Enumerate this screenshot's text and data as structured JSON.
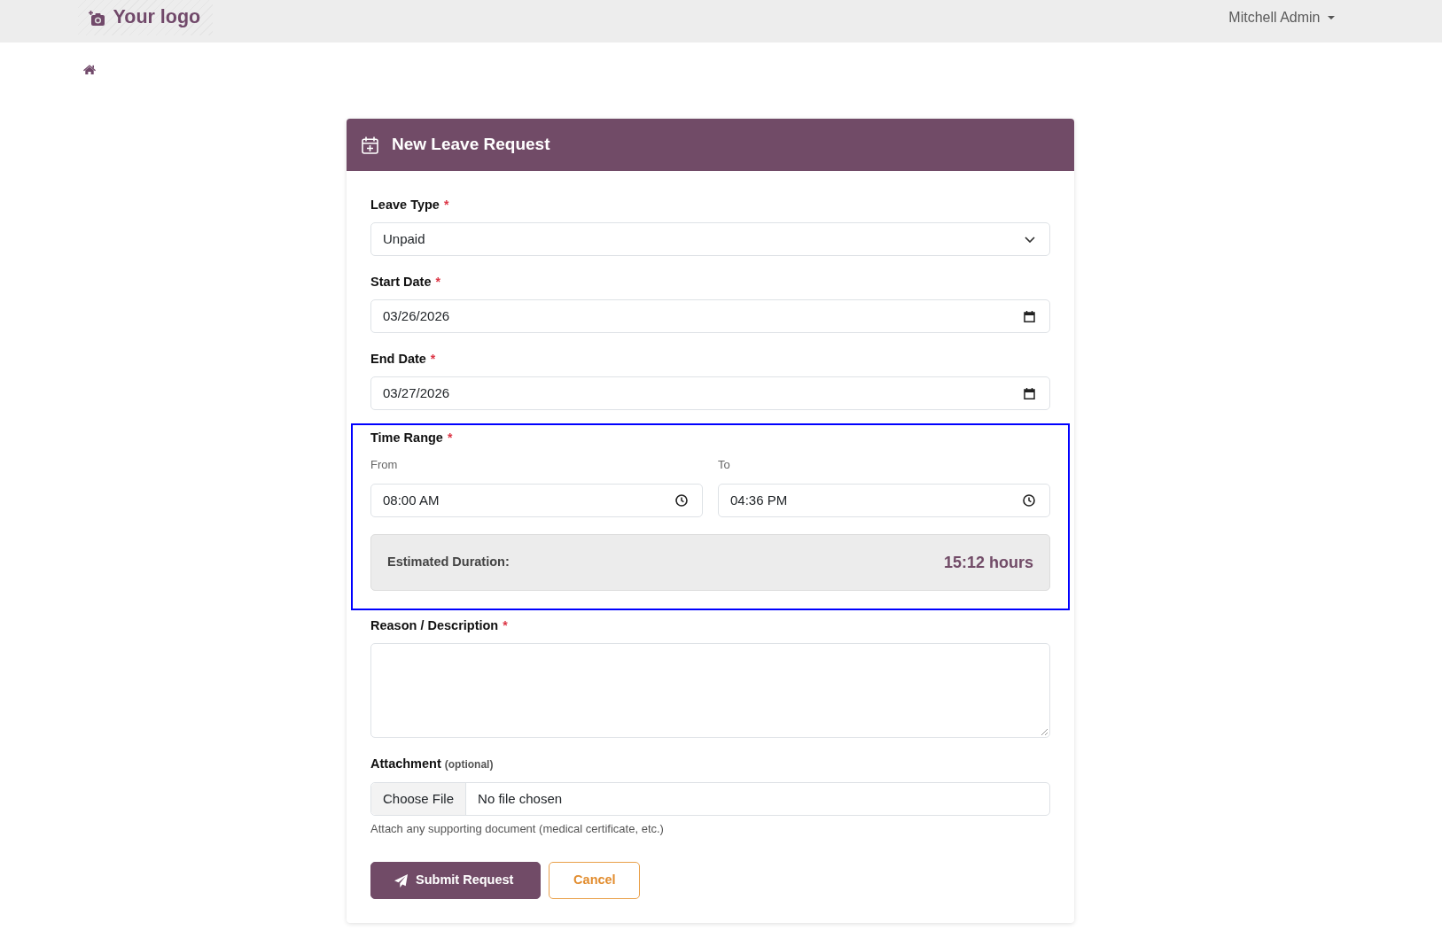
{
  "navbar": {
    "logo": "Your logo",
    "user_menu": "Mitchell Admin"
  },
  "form": {
    "title": "New Leave Request",
    "fields": [
      {
        "kind": "select",
        "label": "Leave Type",
        "required_mark": "*",
        "value": "Unpaid"
      },
      {
        "kind": "date",
        "label": "Start Date",
        "required_mark": "*",
        "value": "03/26/2026"
      },
      {
        "kind": "date",
        "label": "End Date",
        "required_mark": "*",
        "value": "03/27/2026"
      },
      {
        "kind": "time_range",
        "label": "Time Range",
        "required_mark": "*",
        "highlighted": true,
        "from": {
          "label": "From",
          "value": "08:00 AM"
        },
        "to": {
          "label": "To",
          "value": "04:36 PM"
        },
        "duration": {
          "label": "Estimated Duration:",
          "value": "15:12 hours"
        }
      },
      {
        "kind": "textarea",
        "label": "Reason / Description",
        "required_mark": "*"
      },
      {
        "kind": "file",
        "label": "Attachment",
        "note": "(optional)",
        "button": "Choose File",
        "value": "No file chosen",
        "help": "Attach any supporting document (medical certificate, etc.)"
      }
    ],
    "buttons": [
      {
        "kind": "primary",
        "label": "Submit Request"
      },
      {
        "kind": "outline",
        "label": "Cancel"
      }
    ]
  }
}
